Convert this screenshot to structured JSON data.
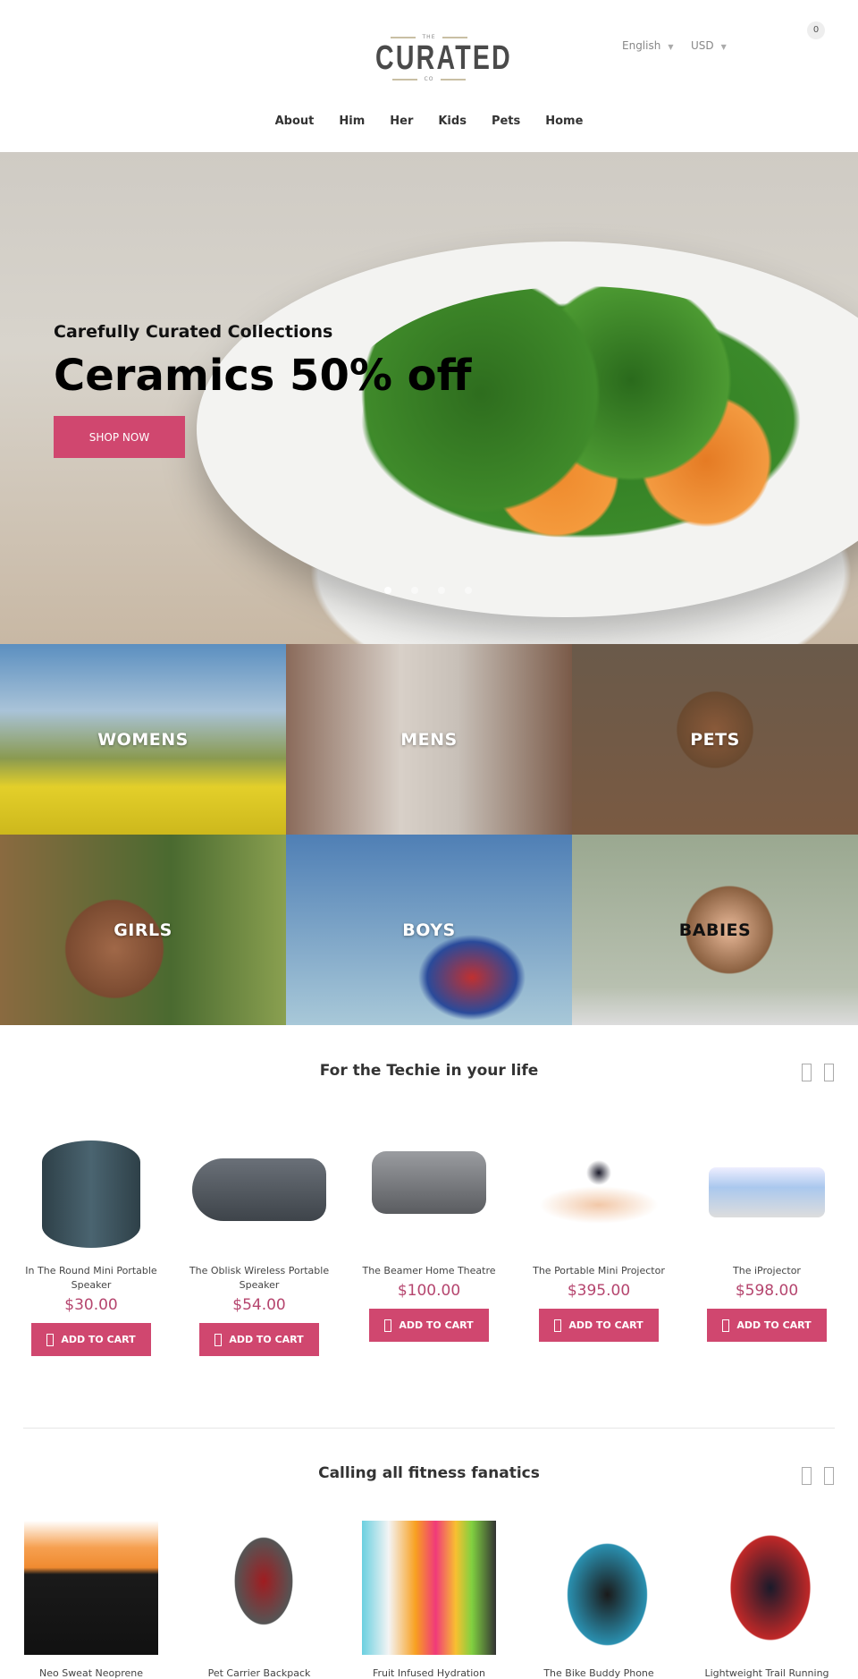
{
  "header": {
    "logo_top": "THE",
    "logo_main": "CURATED",
    "logo_bottom": "CO",
    "language": "English",
    "currency": "USD",
    "cart_count": "0"
  },
  "nav": [
    "About",
    "Him",
    "Her",
    "Kids",
    "Pets",
    "Home"
  ],
  "hero": {
    "subtitle": "Carefully Curated Collections",
    "title": "Ceramics 50% off",
    "button": "SHOP NOW",
    "slides": 4,
    "active_slide": 1
  },
  "categories": [
    {
      "label": "WOMENS",
      "color": "#fff"
    },
    {
      "label": "MENS",
      "color": "#fff"
    },
    {
      "label": "PETS",
      "color": "#fff"
    },
    {
      "label": "GIRLS",
      "color": "#fff"
    },
    {
      "label": "BOYS",
      "color": "#fff"
    },
    {
      "label": "BABIES",
      "color": "#111"
    }
  ],
  "techie": {
    "title": "For the Techie in your life",
    "products": [
      {
        "name": "In The Round Mini Portable Speaker",
        "price": "$30.00",
        "button": "ADD TO CART"
      },
      {
        "name": "The Oblisk Wireless Portable Speaker",
        "price": "$54.00",
        "button": "ADD TO CART"
      },
      {
        "name": "The Beamer Home Theatre",
        "price": "$100.00",
        "button": "ADD TO CART"
      },
      {
        "name": "The Portable Mini Projector",
        "price": "$395.00",
        "button": "ADD TO CART"
      },
      {
        "name": "The iProjector",
        "price": "$598.00",
        "button": "ADD TO CART"
      }
    ]
  },
  "fitness": {
    "title": "Calling all fitness fanatics",
    "products": [
      {
        "name": "Neo Sweat Neoprene"
      },
      {
        "name": "Pet Carrier Backpack"
      },
      {
        "name": "Fruit Infused Hydration"
      },
      {
        "name": "The Bike Buddy Phone"
      },
      {
        "name": "Lightweight Trail Running"
      }
    ]
  },
  "colors": {
    "accent": "#d0476f",
    "price": "#b5456e"
  }
}
